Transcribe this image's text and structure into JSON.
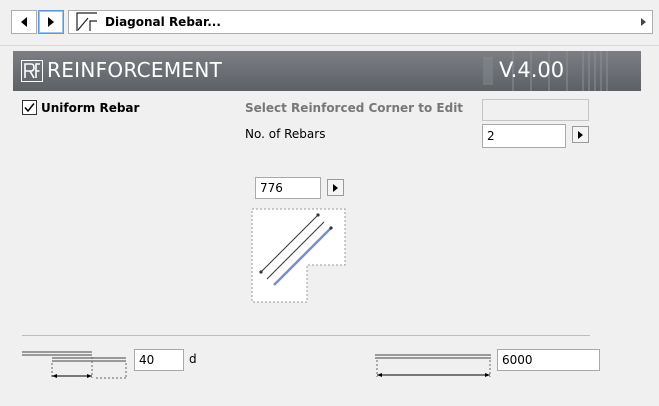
{
  "nav": {
    "prev_icon": "triangle-left-icon",
    "next_icon": "triangle-right-icon",
    "page_icon": "diagonal-rebar-icon",
    "page_label": "Diagonal Rebar...",
    "dropdown_icon": "triangle-right-icon"
  },
  "banner": {
    "logo_icon": "reinforcement-logo-icon",
    "title": "REINFORCEMENT",
    "version": "V.4.00"
  },
  "form": {
    "uniform_rebar": {
      "label": "Uniform Rebar",
      "checked": true
    },
    "corner_label": "Select Reinforced Corner to Edit",
    "corner_value": "",
    "count_label": "No. of Rebars",
    "count_value": "2",
    "length_value": "776",
    "lap_value": "40",
    "lap_unit": "d",
    "total_value": "6000"
  },
  "colors": {
    "banner": "#676b70",
    "rebar_line": "#7b8fbf",
    "focus_border": "#5b9bd5"
  }
}
